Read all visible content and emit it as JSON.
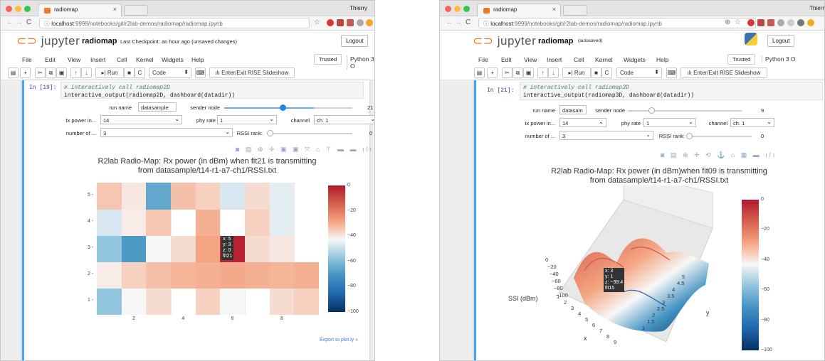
{
  "left": {
    "browser": {
      "tab_title": "radiomap",
      "user": "Thierry",
      "url_host": "localhost",
      "url_rest": ":9999/notebooks/git/r2lab-demos/radiomap/radiomap.ipynb"
    },
    "jupyter": {
      "logo": "jupyter",
      "notebook_name": "radiomap",
      "checkpoint": "Last Checkpoint: an hour ago  (unsaved changes)",
      "logout": "Logout",
      "menus": [
        "File",
        "Edit",
        "View",
        "Insert",
        "Cell",
        "Kernel",
        "Widgets",
        "Help"
      ],
      "trusted": "Trusted",
      "kernel": "Python 3 O",
      "cell_type": "Code",
      "run_label": "Run",
      "rise_label": "Enter/Exit RISE Slideshow"
    },
    "cell": {
      "prompt": "In [19]:",
      "code_comment": "# interactively call radiomap2D",
      "code_line": "interactive_output(radiomap2D, dashboard(datadir))"
    },
    "widgets": {
      "run_name_label": "run name",
      "run_name_value": "datasample",
      "sender_label": "sender node",
      "sender_value": "21",
      "sender_fraction": 0.7,
      "tx_label": "tx power in...",
      "tx_value": "14",
      "phy_label": "phy rate",
      "phy_value": "1",
      "channel_label": "channel",
      "channel_value": "ch. 1",
      "num_label": "number of ...",
      "num_value": "3",
      "rssi_label": "RSSI rank:",
      "rssi_value": "0",
      "rssi_fraction": 0.0
    },
    "modebar": "◙ ▤ ⊕ ✛ ▣ ▣ ⤧ ⌂ ⊤ ▬ ▬ ılı",
    "plot_title_1": "R2lab Radio-Map: Rx power (in dBm) when fit21 is transmitting",
    "plot_title_2": "from datasample/t14-r1-a7-ch1/RSSI.txt",
    "export": "Export to plot.ly »",
    "hover": [
      "x: 5",
      "y: 3",
      "z: 0",
      "fit21"
    ]
  },
  "right": {
    "browser": {
      "tab_title": "radiomap",
      "user": "Thierry",
      "url_host": "localhost",
      "url_rest": ":9999/notebooks/git/r2lab-demos/radiomap/radiomap.ipynb"
    },
    "jupyter": {
      "logo": "jupyter",
      "notebook_name": "radiomap",
      "checkpoint": "(autosaved)",
      "logout": "Logout",
      "menus": [
        "File",
        "Edit",
        "View",
        "Insert",
        "Cell",
        "Kernel",
        "Widgets",
        "Help"
      ],
      "trusted": "Trusted",
      "kernel": "Python 3 O",
      "cell_type": "Code",
      "run_label": "Run",
      "rise_label": "Enter/Exit RISE Slideshow"
    },
    "cell": {
      "prompt": "In [21]:",
      "code_comment": "# interactively call radiomap3D",
      "code_line": "interactive_output(radiomap3D, dashboard(datadir))"
    },
    "widgets": {
      "run_name_label": "run name",
      "run_name_value": "datasam",
      "sender_label": "sender node",
      "sender_value": "9",
      "sender_fraction": 0.3,
      "tx_label": "tx power in...",
      "tx_value": "14",
      "phy_label": "phy rate",
      "phy_value": "1",
      "channel_label": "channel",
      "channel_value": "ch. 1",
      "num_label": "number of ...",
      "num_value": "3",
      "rssi_label": "RSSI rank:",
      "rssi_value": "0",
      "rssi_fraction": 0.0
    },
    "modebar": "◙ ▤ ⊕ ✛ ⟲ ⚓ ⌂ ▦ ▬ ılı",
    "plot_title_1": "R2lab Radio-Map: Rx power (in dBm)when fit09 is transmitting",
    "plot_title_2": "from datasample/t14-r1-a7-ch1/RSSI.txt",
    "hover": [
      "x: 3",
      "y: 1",
      "z: −39.4",
      "fit15"
    ],
    "zaxis_label": "SSI (dBm)",
    "zaxis_ticks": [
      "0",
      "−20",
      "−40",
      "−60",
      "−80",
      "−100"
    ],
    "xaxis_label": "x",
    "xaxis_ticks": [
      "1",
      "2",
      "3",
      "4",
      "5",
      "6",
      "7",
      "8",
      "9"
    ],
    "yaxis_label": "y",
    "yaxis_ticks": [
      "5",
      "4.5",
      "4",
      "3.5",
      "3",
      "2.5",
      "2",
      "1.5",
      "1"
    ]
  },
  "chart_data": [
    {
      "type": "heatmap",
      "title": "R2lab Radio-Map: Rx power (in dBm) when fit21 is transmitting from datasample/t14-r1-a7-ch1/RSSI.txt",
      "x": [
        1,
        2,
        3,
        4,
        5,
        6,
        7,
        8,
        9
      ],
      "y": [
        1,
        2,
        3,
        4,
        5
      ],
      "xticks": [
        "2",
        "4",
        "6",
        "8"
      ],
      "yticks": [
        "1",
        "2",
        "3",
        "4",
        "5"
      ],
      "zrange": [
        -100,
        0
      ],
      "colorbar_ticks": [
        "0",
        "−20",
        "−40",
        "−60",
        "−80",
        "−100"
      ],
      "z": [
        [
          -55,
          -45,
          -40,
          null,
          -38,
          -45,
          null,
          -40,
          -38
        ],
        [
          -43,
          -38,
          -35,
          -33,
          -32,
          -31,
          -32,
          -33,
          -32
        ],
        [
          -55,
          -68,
          -45,
          -40,
          -30,
          -2,
          -40,
          -42,
          null
        ],
        [
          -48,
          -43,
          -36,
          null,
          -32,
          null,
          -38,
          -47,
          null
        ],
        [
          -36,
          -42,
          -64,
          -35,
          -38,
          -48,
          -40,
          -47,
          null
        ]
      ]
    },
    {
      "type": "surface",
      "title": "R2lab Radio-Map: Rx power (in dBm)when fit09 is transmitting from datasample/t14-r1-a7-ch1/RSSI.txt",
      "zlabel": "SSI (dBm)",
      "xlabel": "x",
      "ylabel": "y",
      "xlim": [
        1,
        9
      ],
      "ylim": [
        1,
        5
      ],
      "zlim": [
        -100,
        0
      ],
      "colorbar_ticks": [
        "0",
        "−20",
        "−40",
        "−60",
        "−80",
        "−100"
      ]
    }
  ]
}
